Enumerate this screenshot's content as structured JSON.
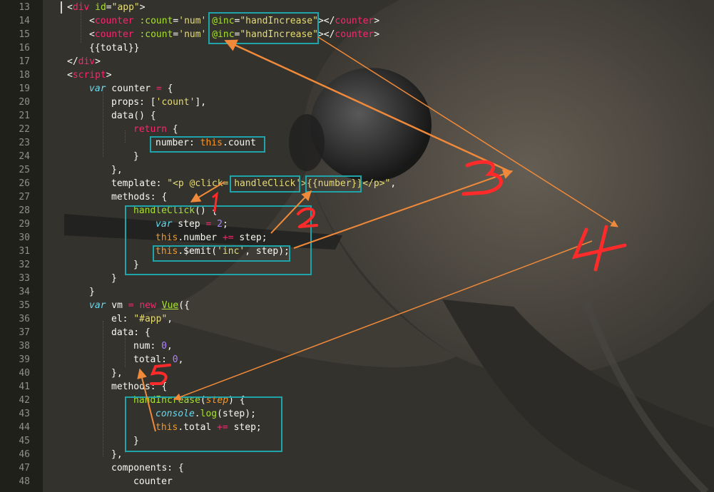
{
  "editor": {
    "lines": [
      {
        "n": "13",
        "t": [
          [
            "t-pl",
            "<"
          ],
          [
            "t-tag",
            "div"
          ],
          [
            "t-pl",
            " "
          ],
          [
            "t-attr",
            "id"
          ],
          [
            "t-pl",
            "="
          ],
          [
            "t-str",
            "\"app\""
          ],
          [
            "t-pl",
            ">"
          ]
        ]
      },
      {
        "n": "14",
        "t": [
          [
            "t-pl",
            "<"
          ],
          [
            "t-tag",
            "counter"
          ],
          [
            "t-pl",
            " "
          ],
          [
            "t-attr",
            ":count"
          ],
          [
            "t-pl",
            "="
          ],
          [
            "t-str",
            "'num'"
          ],
          [
            "t-pl",
            " "
          ],
          [
            "t-attr",
            "@inc"
          ],
          [
            "t-pl",
            "="
          ],
          [
            "t-str",
            "\"handIncrease\""
          ],
          [
            "t-pl",
            "></"
          ],
          [
            "t-tag",
            "counter"
          ],
          [
            "t-pl",
            ">"
          ]
        ]
      },
      {
        "n": "15",
        "t": [
          [
            "t-pl",
            "<"
          ],
          [
            "t-tag",
            "counter"
          ],
          [
            "t-pl",
            " "
          ],
          [
            "t-attr",
            ":count"
          ],
          [
            "t-pl",
            "="
          ],
          [
            "t-str",
            "'num'"
          ],
          [
            "t-pl",
            " "
          ],
          [
            "t-attr",
            "@inc"
          ],
          [
            "t-pl",
            "="
          ],
          [
            "t-str",
            "\"handIncrease\""
          ],
          [
            "t-pl",
            "></"
          ],
          [
            "t-tag",
            "counter"
          ],
          [
            "t-pl",
            ">"
          ]
        ]
      },
      {
        "n": "16",
        "t": [
          [
            "t-pl",
            "{{total}}"
          ]
        ]
      },
      {
        "n": "17",
        "t": [
          [
            "t-pl",
            "</"
          ],
          [
            "t-tag",
            "div"
          ],
          [
            "t-pl",
            ">"
          ]
        ]
      },
      {
        "n": "18",
        "t": [
          [
            "t-pl",
            "<"
          ],
          [
            "t-tag",
            "script"
          ],
          [
            "t-pl",
            ">"
          ]
        ]
      },
      {
        "n": "19",
        "t": [
          [
            "t-kwi",
            "var"
          ],
          [
            "t-pl",
            " counter "
          ],
          [
            "t-kw",
            "="
          ],
          [
            "t-pl",
            " {"
          ]
        ]
      },
      {
        "n": "20",
        "t": [
          [
            "t-pl",
            "props: ["
          ],
          [
            "t-str",
            "'count'"
          ],
          [
            "t-pl",
            "],"
          ]
        ]
      },
      {
        "n": "21",
        "t": [
          [
            "t-pl",
            "data() {"
          ]
        ]
      },
      {
        "n": "22",
        "t": [
          [
            "t-kw",
            "return"
          ],
          [
            "t-pl",
            " {"
          ]
        ]
      },
      {
        "n": "23",
        "t": [
          [
            "t-pl",
            "number: "
          ],
          [
            "t-this",
            "this"
          ],
          [
            "t-pl",
            ".count"
          ]
        ]
      },
      {
        "n": "24",
        "t": [
          [
            "t-pl",
            "}"
          ]
        ]
      },
      {
        "n": "25",
        "t": [
          [
            "t-pl",
            "},"
          ]
        ]
      },
      {
        "n": "26",
        "t": [
          [
            "t-pl",
            "template: "
          ],
          [
            "t-str",
            "\"<p @click= handleClick'>{{number}}</p>\""
          ],
          [
            "t-pl",
            ","
          ]
        ]
      },
      {
        "n": "27",
        "t": [
          [
            "t-pl",
            "methods: {"
          ]
        ]
      },
      {
        "n": "28",
        "t": [
          [
            "t-fn",
            "handleClick"
          ],
          [
            "t-pl",
            "() {"
          ]
        ]
      },
      {
        "n": "29",
        "t": [
          [
            "t-kwi",
            "var"
          ],
          [
            "t-pl",
            " step "
          ],
          [
            "t-kw",
            "="
          ],
          [
            "t-pl",
            " "
          ],
          [
            "t-num",
            "2"
          ],
          [
            "t-pl",
            ";"
          ]
        ]
      },
      {
        "n": "30",
        "t": [
          [
            "t-this",
            "this"
          ],
          [
            "t-pl",
            ".number "
          ],
          [
            "t-kw",
            "+="
          ],
          [
            "t-pl",
            " step;"
          ]
        ]
      },
      {
        "n": "31",
        "t": [
          [
            "t-this",
            "this"
          ],
          [
            "t-pl",
            ".$emit("
          ],
          [
            "t-str",
            "'inc'"
          ],
          [
            "t-pl",
            ", step);"
          ]
        ]
      },
      {
        "n": "32",
        "t": [
          [
            "t-pl",
            "}"
          ]
        ]
      },
      {
        "n": "33",
        "t": [
          [
            "t-pl",
            "}"
          ]
        ]
      },
      {
        "n": "34",
        "t": [
          [
            "t-pl",
            "}"
          ]
        ]
      },
      {
        "n": "35",
        "t": [
          [
            "t-kwi",
            "var"
          ],
          [
            "t-pl",
            " vm "
          ],
          [
            "t-kw",
            "="
          ],
          [
            "t-pl",
            " "
          ],
          [
            "t-kw",
            "new"
          ],
          [
            "t-pl",
            " "
          ],
          [
            "t-cls",
            "Vue"
          ],
          [
            "t-pl",
            "({"
          ]
        ]
      },
      {
        "n": "36",
        "t": [
          [
            "t-pl",
            "el: "
          ],
          [
            "t-str",
            "\"#app\""
          ],
          [
            "t-pl",
            ","
          ]
        ]
      },
      {
        "n": "37",
        "t": [
          [
            "t-pl",
            "data: {"
          ]
        ]
      },
      {
        "n": "38",
        "t": [
          [
            "t-pl",
            "num: "
          ],
          [
            "t-num",
            "0"
          ],
          [
            "t-pl",
            ","
          ]
        ]
      },
      {
        "n": "39",
        "t": [
          [
            "t-pl",
            "total: "
          ],
          [
            "t-num",
            "0"
          ],
          [
            "t-pl",
            ","
          ]
        ]
      },
      {
        "n": "40",
        "t": [
          [
            "t-pl",
            "},"
          ]
        ]
      },
      {
        "n": "41",
        "t": [
          [
            "t-pl",
            "methods: {"
          ]
        ]
      },
      {
        "n": "42",
        "t": [
          [
            "t-fn",
            "handIncrease"
          ],
          [
            "t-pl",
            "("
          ],
          [
            "t-ital",
            "step"
          ],
          [
            "t-pl",
            ") {"
          ]
        ]
      },
      {
        "n": "43",
        "t": [
          [
            "t-con",
            "console"
          ],
          [
            "t-pl",
            "."
          ],
          [
            "t-fn",
            "log"
          ],
          [
            "t-pl",
            "(step);"
          ]
        ]
      },
      {
        "n": "44",
        "t": [
          [
            "t-this",
            "this"
          ],
          [
            "t-pl",
            ".total "
          ],
          [
            "t-kw",
            "+="
          ],
          [
            "t-pl",
            " step;"
          ]
        ]
      },
      {
        "n": "45",
        "t": [
          [
            "t-pl",
            "}"
          ]
        ]
      },
      {
        "n": "46",
        "t": [
          [
            "t-pl",
            "},"
          ]
        ]
      },
      {
        "n": "47",
        "t": [
          [
            "t-pl",
            "components: {"
          ]
        ]
      },
      {
        "n": "48",
        "t": [
          [
            "t-pl",
            "counter"
          ]
        ]
      }
    ]
  },
  "annotations": {
    "labels": [
      "1",
      "2",
      "3",
      "4",
      "5"
    ],
    "box_color": "#1fa4a9",
    "arrow_color": "#f08a3a",
    "label_color": "#ff2a2a"
  }
}
